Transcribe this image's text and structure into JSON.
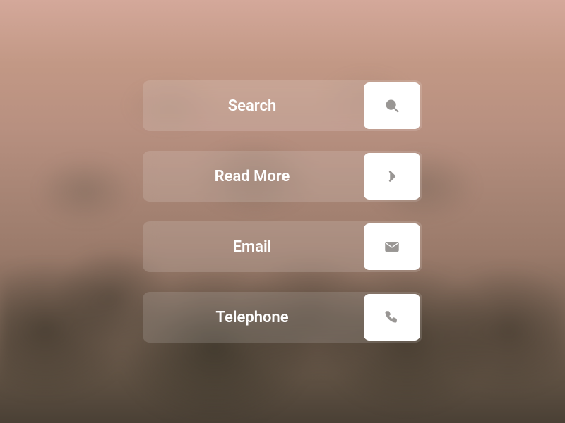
{
  "buttons": [
    {
      "label": "Search",
      "icon": "search"
    },
    {
      "label": "Read More",
      "icon": "chevron-right"
    },
    {
      "label": "Email",
      "icon": "envelope"
    },
    {
      "label": "Telephone",
      "icon": "phone"
    }
  ]
}
